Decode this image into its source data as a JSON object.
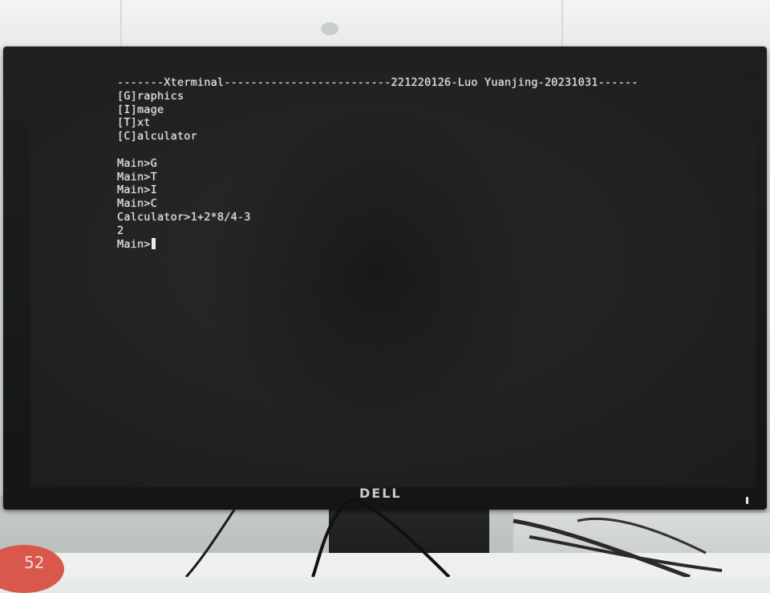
{
  "terminal": {
    "lines": [
      "-------Xterminal-------------------------221220126-Luo Yuanjing-20231031------",
      "[G]raphics",
      "[I]mage",
      "[T]xt",
      "[C]alculator",
      "",
      "Main>G",
      "Main>T",
      "Main>I",
      "Main>C",
      "Calculator>1+2*8/4-3",
      "2"
    ],
    "prompt": "Main>"
  },
  "monitor": {
    "brand": "DELL"
  },
  "sticker": {
    "text": "52"
  }
}
